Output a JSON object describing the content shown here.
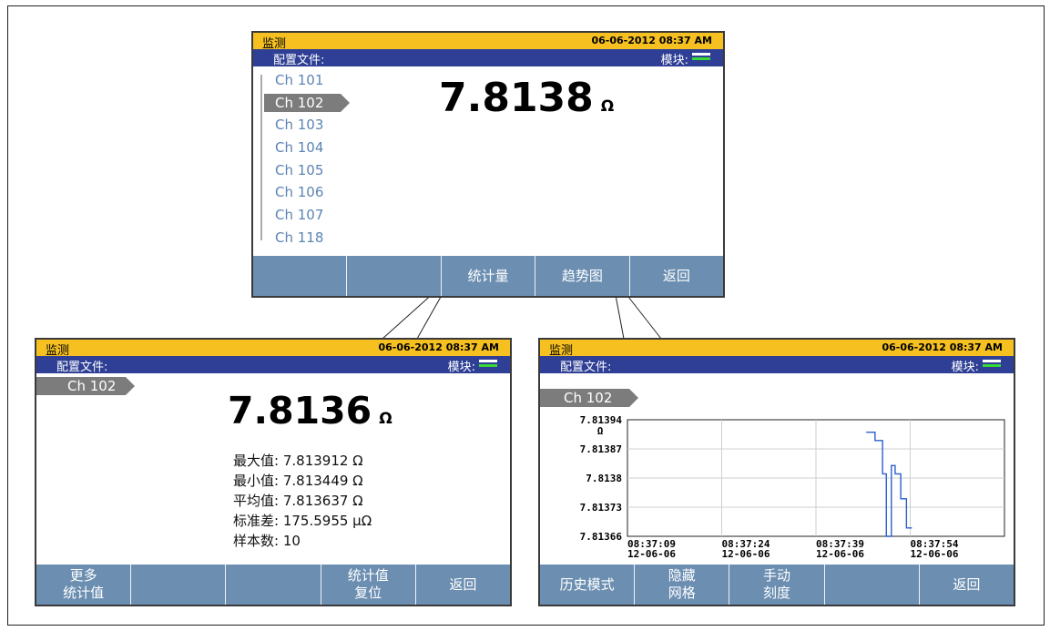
{
  "common": {
    "title": "监测",
    "datetime": "06-06-2012 08:37 AM",
    "profile_label": "配置文件:",
    "module_label": "模块:",
    "unit": "Ω"
  },
  "top_screen": {
    "value": "7.8138",
    "channels": [
      "Ch 101",
      "Ch 102",
      "Ch 103",
      "Ch 104",
      "Ch 105",
      "Ch 106",
      "Ch 107",
      "Ch 118"
    ],
    "selected_channel": "Ch 102",
    "softkeys": [
      "",
      "",
      "统计量",
      "趋势图",
      "返回"
    ]
  },
  "stats_screen": {
    "channel": "Ch 102",
    "value": "7.8136",
    "stats": [
      {
        "label": "最大值:",
        "value": "7.813912 Ω"
      },
      {
        "label": "最小值:",
        "value": "7.813449 Ω"
      },
      {
        "label": "平均值:",
        "value": "7.813637 Ω"
      },
      {
        "label": "标准差:",
        "value": "175.5955 μΩ"
      },
      {
        "label": "样本数:",
        "value": "10"
      }
    ],
    "softkeys": [
      "更多\n统计值",
      "",
      "",
      "统计值\n复位",
      "返回"
    ]
  },
  "trend_screen": {
    "channel": "Ch 102",
    "softkeys": [
      "历史模式",
      "隐藏\n网格",
      "手动\n刻度",
      "",
      "返回"
    ]
  },
  "chart_data": {
    "type": "line",
    "ylabel": "Ω",
    "y_ticks": [
      "7.81394",
      "7.81387",
      "7.8138",
      "7.81373",
      "7.81366"
    ],
    "x_ticks": [
      {
        "time": "08:37:09",
        "date": "12-06-06"
      },
      {
        "time": "08:37:24",
        "date": "12-06-06"
      },
      {
        "time": "08:37:39",
        "date": "12-06-06"
      },
      {
        "time": "08:37:54",
        "date": "12-06-06"
      }
    ],
    "ylim": [
      7.81366,
      7.81394
    ],
    "xlim_seconds": [
      0,
      60
    ],
    "grid": true,
    "line_color": "#2c5fd0",
    "series": [
      {
        "x": [
          38.0,
          39.4,
          40.6,
          41.2,
          42.0,
          42.6,
          43.5,
          44.4
        ],
        "y": [
          7.81391,
          7.81389,
          7.81381,
          7.81366,
          7.81383,
          7.81381,
          7.81375,
          7.81368
        ]
      }
    ]
  }
}
